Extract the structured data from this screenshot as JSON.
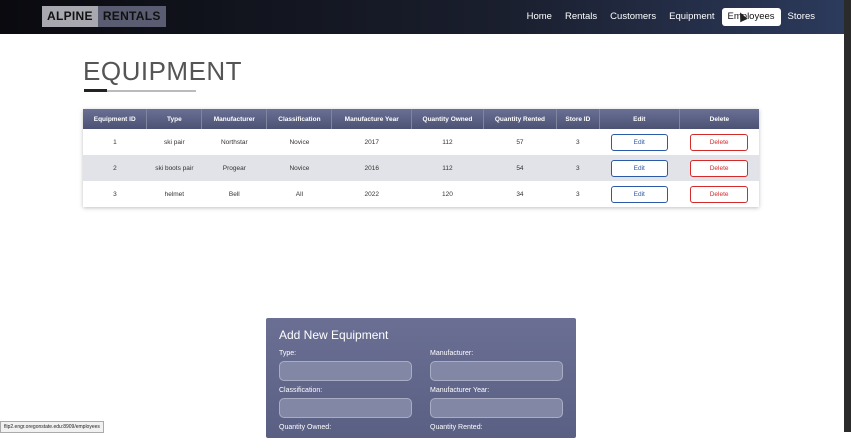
{
  "brand": {
    "part1": "ALPINE",
    "part2": "RENTALS"
  },
  "nav": {
    "items": [
      {
        "label": "Home",
        "active": false
      },
      {
        "label": "Rentals",
        "active": false
      },
      {
        "label": "Customers",
        "active": false
      },
      {
        "label": "Equipment",
        "active": false
      },
      {
        "label": "Employees",
        "active": true
      },
      {
        "label": "Stores",
        "active": false
      }
    ]
  },
  "page": {
    "title": "EQUIPMENT"
  },
  "table": {
    "headers": [
      "Equipment ID",
      "Type",
      "Manufacturer",
      "Classification",
      "Manufacture Year",
      "Quantity Owned",
      "Quantity Rented",
      "Store ID",
      "Edit",
      "Delete"
    ],
    "rows": [
      {
        "id": "1",
        "type": "ski pair",
        "manufacturer": "Northstar",
        "classification": "Novice",
        "year": "2017",
        "owned": "112",
        "rented": "57",
        "store": "3",
        "edit": "Edit",
        "delete": "Delete"
      },
      {
        "id": "2",
        "type": "ski boots pair",
        "manufacturer": "Progear",
        "classification": "Novice",
        "year": "2016",
        "owned": "112",
        "rented": "54",
        "store": "3",
        "edit": "Edit",
        "delete": "Delete"
      },
      {
        "id": "3",
        "type": "helmet",
        "manufacturer": "Bell",
        "classification": "All",
        "year": "2022",
        "owned": "120",
        "rented": "34",
        "store": "3",
        "edit": "Edit",
        "delete": "Delete"
      }
    ]
  },
  "form": {
    "title": "Add New Equipment",
    "labels": {
      "type": "Type:",
      "manufacturer": "Manufacturer:",
      "classification": "Classification:",
      "manufacture_year": "Manufacturer Year:",
      "quantity_owned": "Quantity Owned:",
      "quantity_rented": "Quantity Rented:"
    }
  },
  "status_bar": {
    "url": "flip2.engr.oregonstate.edu:8909/employees"
  },
  "colors": {
    "header_bg": "#4c5274",
    "edit": "#2b5aa8",
    "delete": "#d42a2a",
    "form_bg": "#5a5f84"
  }
}
